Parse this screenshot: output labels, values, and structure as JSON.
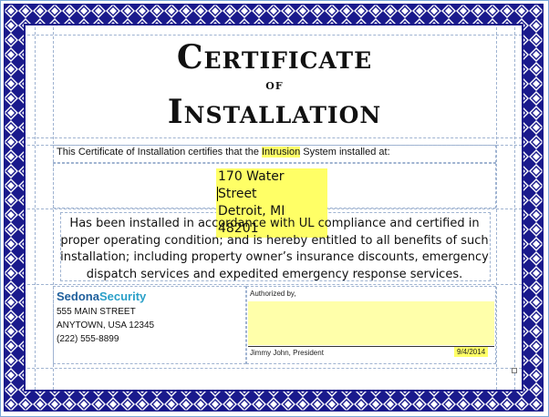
{
  "certificate": {
    "title_line1": "Certificate",
    "title_line2": "of",
    "title_line3": "Installation",
    "intro_before": "This Certificate of Installation certifies that the ",
    "system_type": "Intrusion",
    "intro_after": " System installed at:",
    "address_line1": "170  Water Street",
    "address_line2": "Detroit, MI  48201",
    "body_text": "Has been installed in accordance with UL compliance and certified in proper operating condition; and is hereby entitled to all benefits of such installation; including property owner’s insurance discounts, emergency dispatch services and expedited emergency response services."
  },
  "company": {
    "name_part1": "Sedona",
    "name_part2": "Security",
    "street": "555 MAIN STREET",
    "city": "ANYTOWN, USA  12345",
    "phone": "(222) 555-8899"
  },
  "signature": {
    "label": "Authorized by,",
    "name": "Jimmy John, President",
    "date": "9/4/2014"
  },
  "colors": {
    "border_blue": "#1a1a8c",
    "highlight": "#ffff66",
    "brand_dark": "#1f5f9c",
    "brand_light": "#2aa0c8"
  }
}
